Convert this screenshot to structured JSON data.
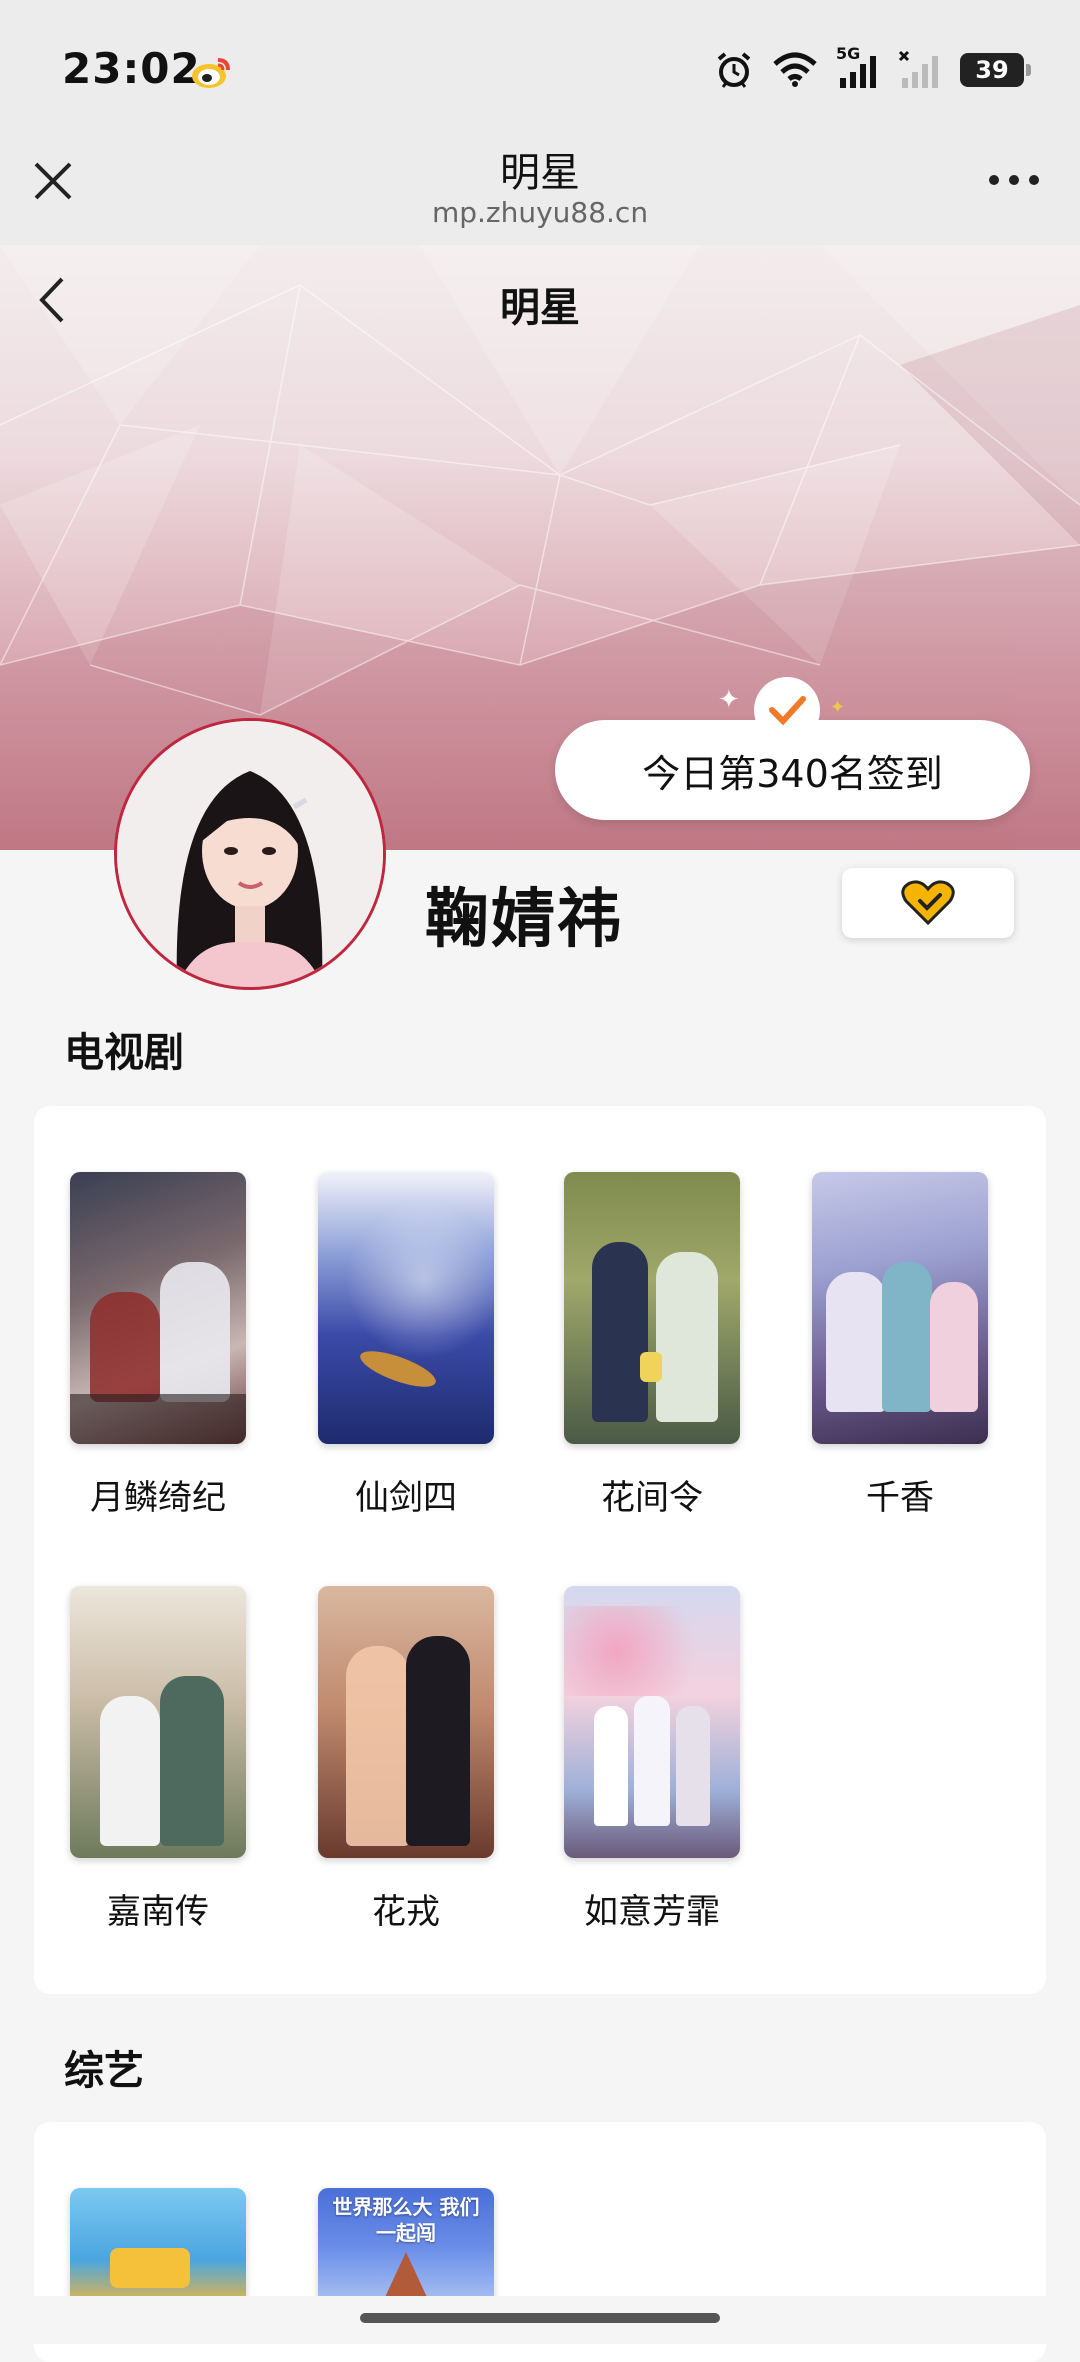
{
  "status_bar": {
    "time": "23:02",
    "network": "5G",
    "battery": "39"
  },
  "browser": {
    "title": "明星",
    "url": "mp.zhuyu88.cn"
  },
  "page": {
    "title": "明星"
  },
  "checkin": {
    "text": "今日第340名签到"
  },
  "star": {
    "name": "鞠婧祎"
  },
  "sections": {
    "tv": {
      "title": "电视剧",
      "items": [
        {
          "label": "月鳞绮纪"
        },
        {
          "label": "仙剑四"
        },
        {
          "label": "花间令"
        },
        {
          "label": "千香"
        },
        {
          "label": "嘉南传"
        },
        {
          "label": "花戎"
        },
        {
          "label": "如意芳霏"
        }
      ]
    },
    "variety": {
      "title": "综艺",
      "items": [
        {
          "label": ""
        },
        {
          "label": "世界那么大 我们一起闯"
        }
      ]
    }
  },
  "colors": {
    "accent": "#c0263e",
    "heart": "#f5b400",
    "check": "#f07a2a"
  }
}
